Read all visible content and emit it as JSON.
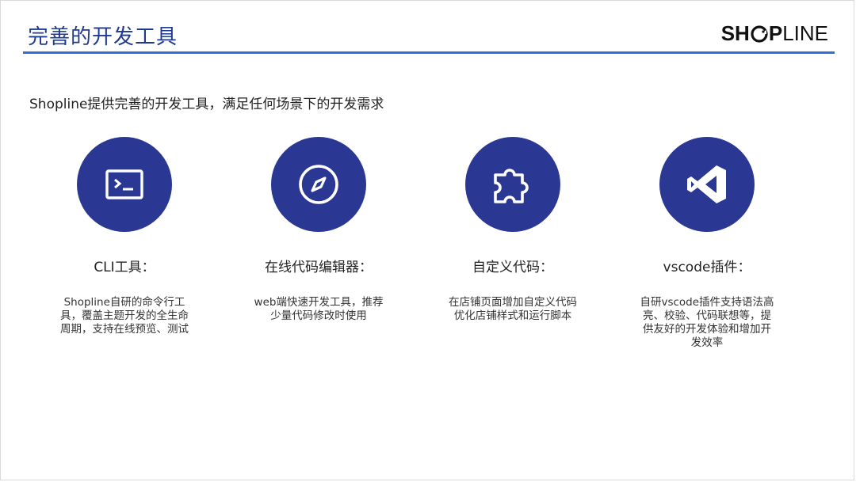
{
  "slide": {
    "title": "完善的开发工具",
    "logo": {
      "part1": "SH",
      "part2": "P",
      "part3": "LINE"
    },
    "subtitle": "Shopline提供完善的开发工具，满足任何场景下的开发需求",
    "accent_color": "#2f6fde",
    "circle_color": "#2a3893"
  },
  "features": [
    {
      "icon": "terminal-icon",
      "title": "CLI工具：",
      "description": "Shopline自研的命令行工具，覆盖主题开发的全生命周期，支持在线预览、测试"
    },
    {
      "icon": "compass-icon",
      "title": "在线代码编辑器：",
      "description": "web端快速开发工具，推荐少量代码修改时使用"
    },
    {
      "icon": "puzzle-icon",
      "title": "自定义代码：",
      "description": "在店铺页面增加自定义代码优化店铺样式和运行脚本"
    },
    {
      "icon": "vscode-icon",
      "title": "vscode插件：",
      "description": "自研vscode插件支持语法高亮、校验、代码联想等，提供友好的开发体验和增加开发效率"
    }
  ]
}
